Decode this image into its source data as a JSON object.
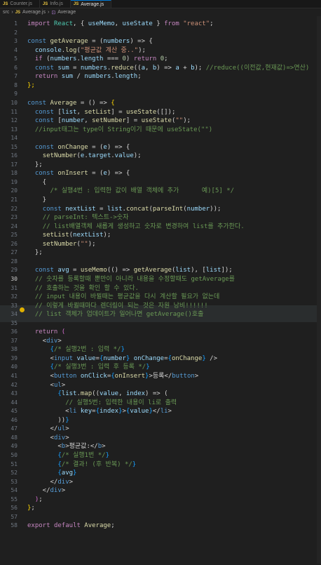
{
  "tabs": [
    {
      "label": "Counter.js",
      "active": false
    },
    {
      "label": "Info.js",
      "active": false
    },
    {
      "label": "Average.js",
      "active": true
    }
  ],
  "breadcrumb": {
    "folder": "src",
    "file": "Average.js",
    "symbol": "Average"
  },
  "editor": {
    "current_line": 30,
    "lines": [
      [
        [
          "c",
          "import "
        ],
        [
          "t",
          "React"
        ],
        [
          "",
          "",
          ""
        ],
        [
          "",
          ", { "
        ],
        [
          "v",
          "useMemo"
        ],
        [
          "",
          ", "
        ],
        [
          "v",
          "useState"
        ],
        [
          "",
          " } "
        ],
        [
          "c",
          "from "
        ],
        [
          "s",
          "\"react\""
        ],
        [
          "",
          ";"
        ]
      ],
      [],
      [
        [
          "k",
          "const "
        ],
        [
          "f",
          "getAverage"
        ],
        [
          "",
          " = ("
        ],
        [
          "v",
          "numbers"
        ],
        [
          "",
          ") => {"
        ]
      ],
      [
        [
          "",
          "  "
        ],
        [
          "v",
          "console"
        ],
        [
          "",
          "."
        ],
        [
          "f",
          "log"
        ],
        [
          "",
          "("
        ],
        [
          "s",
          "\"평균값 계산 중..\""
        ],
        [
          "",
          ");"
        ]
      ],
      [
        [
          "",
          "  "
        ],
        [
          "c",
          "if "
        ],
        [
          "",
          "("
        ],
        [
          "v",
          "numbers"
        ],
        [
          "",
          "."
        ],
        [
          "v",
          "length"
        ],
        [
          "",
          " === "
        ],
        [
          "n",
          "0"
        ],
        [
          "",
          ") "
        ],
        [
          "c",
          "return "
        ],
        [
          "n",
          "0"
        ],
        [
          "",
          ";"
        ]
      ],
      [
        [
          "",
          "  "
        ],
        [
          "k",
          "const "
        ],
        [
          "v",
          "sum"
        ],
        [
          "",
          " = "
        ],
        [
          "v",
          "numbers"
        ],
        [
          "",
          "."
        ],
        [
          "f",
          "reduce"
        ],
        [
          "",
          "(("
        ],
        [
          "v",
          "a"
        ],
        [
          "",
          ", "
        ],
        [
          "v",
          "b"
        ],
        [
          "",
          ") => "
        ],
        [
          "v",
          "a"
        ],
        [
          "",
          " + "
        ],
        [
          "v",
          "b"
        ],
        [
          "",
          "); "
        ],
        [
          "cm",
          "//reduce((이전값,현재값)=>연산)"
        ]
      ],
      [
        [
          "",
          "  "
        ],
        [
          "c",
          "return "
        ],
        [
          "v",
          "sum"
        ],
        [
          "",
          " / "
        ],
        [
          "v",
          "numbers"
        ],
        [
          "",
          "."
        ],
        [
          "v",
          "length"
        ],
        [
          "",
          ";"
        ]
      ],
      [
        [
          "b1",
          "};"
        ]
      ],
      [],
      [
        [
          "k",
          "const "
        ],
        [
          "f",
          "Average"
        ],
        [
          "",
          " = () => "
        ],
        [
          "b1",
          "{"
        ]
      ],
      [
        [
          "",
          "  "
        ],
        [
          "k",
          "const "
        ],
        [
          "",
          "["
        ],
        [
          "v",
          "list"
        ],
        [
          "",
          ", "
        ],
        [
          "f",
          "setList"
        ],
        [
          "",
          "] = "
        ],
        [
          "f",
          "useState"
        ],
        [
          "",
          "(["
        ],
        [
          "",
          "]);"
        ]
      ],
      [
        [
          "",
          "  "
        ],
        [
          "k",
          "const "
        ],
        [
          "",
          "["
        ],
        [
          "v",
          "number"
        ],
        [
          "",
          ", "
        ],
        [
          "f",
          "setNumber"
        ],
        [
          "",
          "] = "
        ],
        [
          "f",
          "useState"
        ],
        [
          "",
          "("
        ],
        [
          "s",
          "\"\""
        ],
        [
          "",
          ");"
        ]
      ],
      [
        [
          "",
          "  "
        ],
        [
          "cm",
          "//input태그는 type이 String이기 때문에 useState(\"\")"
        ]
      ],
      [],
      [
        [
          "",
          "  "
        ],
        [
          "k",
          "const "
        ],
        [
          "f",
          "onChange"
        ],
        [
          "",
          " = ("
        ],
        [
          "v",
          "e"
        ],
        [
          "",
          ") => {"
        ]
      ],
      [
        [
          "",
          "    "
        ],
        [
          "f",
          "setNumber"
        ],
        [
          "",
          "("
        ],
        [
          "v",
          "e"
        ],
        [
          "",
          "."
        ],
        [
          "v",
          "target"
        ],
        [
          "",
          "."
        ],
        [
          "v",
          "value"
        ],
        [
          "",
          ");"
        ]
      ],
      [
        [
          "",
          "  };"
        ]
      ],
      [
        [
          "",
          "  "
        ],
        [
          "k",
          "const "
        ],
        [
          "f",
          "onInsert"
        ],
        [
          "",
          " = ("
        ],
        [
          "v",
          "e"
        ],
        [
          "",
          ") => {"
        ]
      ],
      [
        [
          "",
          "    {"
        ]
      ],
      [
        [
          "",
          "      "
        ],
        [
          "cm",
          "/* 실행4번 : 입력한 값이 배열 객체에 추가      예)[5] */"
        ]
      ],
      [
        [
          "",
          "    }"
        ]
      ],
      [
        [
          "",
          "    "
        ],
        [
          "k",
          "const "
        ],
        [
          "v",
          "nextList"
        ],
        [
          "",
          " = "
        ],
        [
          "v",
          "list"
        ],
        [
          "",
          "."
        ],
        [
          "f",
          "concat"
        ],
        [
          "",
          "("
        ],
        [
          "f",
          "parseInt"
        ],
        [
          "",
          "("
        ],
        [
          "v",
          "number"
        ],
        [
          "",
          "));"
        ]
      ],
      [
        [
          "",
          "    "
        ],
        [
          "cm",
          "// parseInt: 텍스트->숫자"
        ]
      ],
      [
        [
          "",
          "    "
        ],
        [
          "cm",
          "// list배열객체 새롭게 생성하고 숫자로 변경하여 list를 추가한다."
        ]
      ],
      [
        [
          "",
          "    "
        ],
        [
          "f",
          "setList"
        ],
        [
          "",
          "("
        ],
        [
          "v",
          "nextList"
        ],
        [
          "",
          ");"
        ]
      ],
      [
        [
          "",
          "    "
        ],
        [
          "f",
          "setNumber"
        ],
        [
          "",
          "("
        ],
        [
          "s",
          "\"\""
        ],
        [
          "",
          ");"
        ]
      ],
      [
        [
          "",
          "  };"
        ]
      ],
      [],
      [
        [
          "",
          "  "
        ],
        [
          "k",
          "const "
        ],
        [
          "v",
          "avg"
        ],
        [
          "",
          " = "
        ],
        [
          "f",
          "useMemo"
        ],
        [
          "",
          "(() => "
        ],
        [
          "f",
          "getAverage"
        ],
        [
          "",
          "("
        ],
        [
          "v",
          "list"
        ],
        [
          "",
          "), ["
        ],
        [
          "v",
          "list"
        ],
        [
          "",
          "]);"
        ]
      ],
      [
        [
          "",
          "  "
        ],
        [
          "cm",
          "// 숫자를 등록할때 뿐만이 아니라 내용을 수정할때도 getAverage를"
        ]
      ],
      [
        [
          "",
          "  "
        ],
        [
          "cm",
          "// 호출하는 것을 확인 할 수 있다."
        ]
      ],
      [
        [
          "",
          "  "
        ],
        [
          "cm",
          "// input 내용이 바뀔때는 평균값을 다시 계산할 필요가 없는데"
        ]
      ],
      [
        [
          "",
          "  "
        ],
        [
          "cm",
          "// 이렇게 바뀔때마다 렌더링이 되는 것은 자원 낭비!!!!!!"
        ]
      ],
      [
        [
          "",
          "  "
        ],
        [
          "cm",
          "// list 객체가 업데이트가 일어나면 getAverage()호출"
        ]
      ],
      [],
      [
        [
          "",
          "  "
        ],
        [
          "c",
          "return "
        ],
        [
          "b2",
          "("
        ]
      ],
      [
        [
          "",
          "    <"
        ],
        [
          "k",
          "div"
        ],
        [
          "",
          ">"
        ]
      ],
      [
        [
          "",
          "      "
        ],
        [
          "b3",
          "{"
        ],
        [
          "cm",
          "/* 실행2번 : 입력 */"
        ],
        [
          "b3",
          "}"
        ]
      ],
      [
        [
          "",
          "      <"
        ],
        [
          "k",
          "input "
        ],
        [
          "v",
          "value"
        ],
        [
          "",
          "="
        ],
        [
          "b3",
          "{"
        ],
        [
          "v",
          "number"
        ],
        [
          "b3",
          "}"
        ],
        [
          "v",
          " onChange"
        ],
        [
          "",
          "="
        ],
        [
          "b3",
          "{"
        ],
        [
          "f",
          "onChange"
        ],
        [
          "b3",
          "}"
        ],
        [
          "",
          " />"
        ]
      ],
      [
        [
          "",
          "      "
        ],
        [
          "b3",
          "{"
        ],
        [
          "cm",
          "/* 실행3번 : 입력 후 등록 */"
        ],
        [
          "b3",
          "}"
        ]
      ],
      [
        [
          "",
          "      <"
        ],
        [
          "k",
          "button "
        ],
        [
          "v",
          "onClick"
        ],
        [
          "",
          "="
        ],
        [
          "b3",
          "{"
        ],
        [
          "f",
          "onInsert"
        ],
        [
          "b3",
          "}"
        ],
        [
          "",
          ">등록</"
        ],
        [
          "k",
          "button"
        ],
        [
          "",
          ">"
        ]
      ],
      [
        [
          "",
          "      <"
        ],
        [
          "k",
          "ul"
        ],
        [
          "",
          ">"
        ]
      ],
      [
        [
          "",
          "        "
        ],
        [
          "b3",
          "{"
        ],
        [
          "v",
          "list"
        ],
        [
          "",
          "."
        ],
        [
          "f",
          "map"
        ],
        [
          "",
          "(("
        ],
        [
          "v",
          "value"
        ],
        [
          "",
          ", "
        ],
        [
          "v",
          "index"
        ],
        [
          "",
          ") => ("
        ]
      ],
      [
        [
          "",
          "          "
        ],
        [
          "cm",
          "// 실행5번: 입력한 내용이 li로 출력"
        ]
      ],
      [
        [
          "",
          "          <"
        ],
        [
          "k",
          "li "
        ],
        [
          "v",
          "key"
        ],
        [
          "",
          "="
        ],
        [
          "b3",
          "{"
        ],
        [
          "v",
          "index"
        ],
        [
          "b3",
          "}"
        ],
        [
          "",
          ">"
        ],
        [
          "b3",
          "{"
        ],
        [
          "v",
          "value"
        ],
        [
          "b3",
          "}"
        ],
        [
          "",
          "</"
        ],
        [
          "k",
          "li"
        ],
        [
          "",
          ">"
        ]
      ],
      [
        [
          "",
          "        ))"
        ],
        [
          "b3",
          "}"
        ]
      ],
      [
        [
          "",
          "      </"
        ],
        [
          "k",
          "ul"
        ],
        [
          "",
          ">"
        ]
      ],
      [
        [
          "",
          "      <"
        ],
        [
          "k",
          "div"
        ],
        [
          "",
          ">"
        ]
      ],
      [
        [
          "",
          "        <"
        ],
        [
          "k",
          "b"
        ],
        [
          "",
          ">평균값:</"
        ],
        [
          "k",
          "b"
        ],
        [
          "",
          ">"
        ]
      ],
      [
        [
          "",
          "        "
        ],
        [
          "b3",
          "{"
        ],
        [
          "cm",
          "/* 실행1번 */"
        ],
        [
          "b3",
          "}"
        ]
      ],
      [
        [
          "",
          "        "
        ],
        [
          "b3",
          "{"
        ],
        [
          "cm",
          "/* 결과! (후 반복) */"
        ],
        [
          "b3",
          "}"
        ]
      ],
      [
        [
          "",
          "        "
        ],
        [
          "b3",
          "{"
        ],
        [
          "v",
          "avg"
        ],
        [
          "b3",
          "}"
        ]
      ],
      [
        [
          "",
          "      </"
        ],
        [
          "k",
          "div"
        ],
        [
          "",
          ">"
        ]
      ],
      [
        [
          "",
          "    </"
        ],
        [
          "k",
          "div"
        ],
        [
          "",
          ">"
        ]
      ],
      [
        [
          "",
          "  "
        ],
        [
          "b2",
          ")"
        ],
        [
          "",
          ";"
        ]
      ],
      [
        [
          "b1",
          "}"
        ],
        [
          "",
          ";"
        ]
      ],
      [],
      [
        [
          "c",
          "export "
        ],
        [
          "c",
          "default "
        ],
        [
          "f",
          "Average"
        ],
        [
          "",
          ";"
        ]
      ]
    ]
  }
}
